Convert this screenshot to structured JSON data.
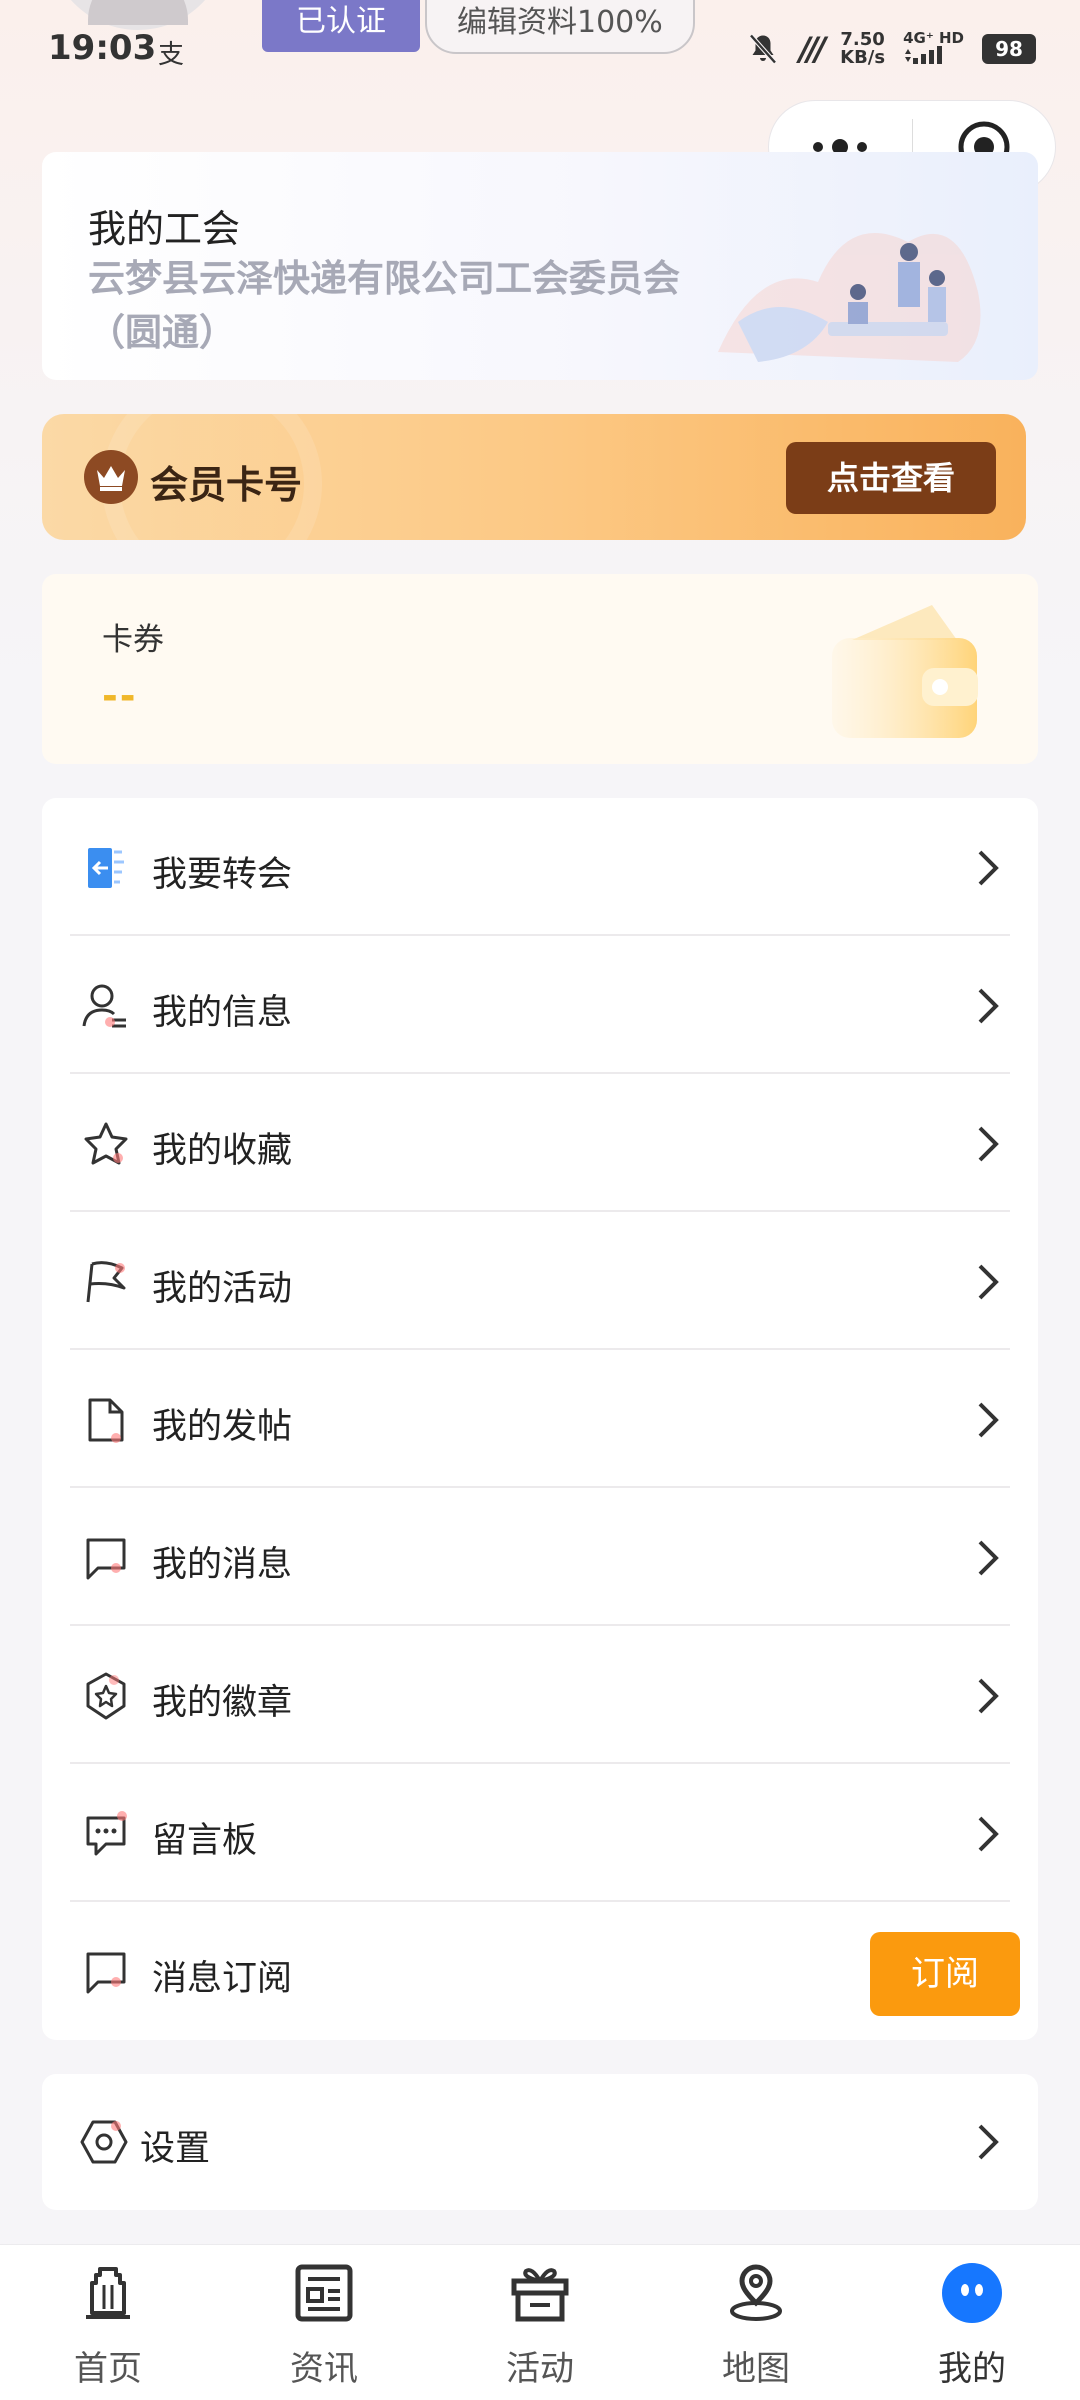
{
  "status_bar": {
    "time": "19:03",
    "pay_icon": "支",
    "net_speed_value": "7.50",
    "net_speed_unit": "KB/s",
    "net_type": "4G⁺ HD",
    "battery": "98"
  },
  "profile": {
    "verified_label": "已认证",
    "completion_label": "编辑资料100%"
  },
  "union": {
    "title": "我的工会",
    "name": "云梦县云泽快递有限公司工会委员会（圆通）"
  },
  "member_card": {
    "label": "会员卡号",
    "button_label": "点击查看"
  },
  "coupon": {
    "label": "卡券",
    "value": "--"
  },
  "menu": {
    "items": [
      {
        "label": "我要转会",
        "icon": "transfer-icon"
      },
      {
        "label": "我的信息",
        "icon": "user-info-icon"
      },
      {
        "label": "我的收藏",
        "icon": "star-icon"
      },
      {
        "label": "我的活动",
        "icon": "flag-icon"
      },
      {
        "label": "我的发帖",
        "icon": "document-icon"
      },
      {
        "label": "我的消息",
        "icon": "message-icon"
      },
      {
        "label": "我的徽章",
        "icon": "badge-icon"
      },
      {
        "label": "留言板",
        "icon": "comment-icon"
      },
      {
        "label": "消息订阅",
        "icon": "subscribe-icon"
      }
    ],
    "subscribe_button": "订阅"
  },
  "settings": {
    "label": "设置",
    "icon": "settings-icon"
  },
  "tabs": [
    {
      "label": "首页",
      "icon": "home-icon"
    },
    {
      "label": "资讯",
      "icon": "news-icon"
    },
    {
      "label": "活动",
      "icon": "gift-icon"
    },
    {
      "label": "地图",
      "icon": "map-pin-icon"
    },
    {
      "label": "我的",
      "icon": "profile-icon",
      "active": true
    }
  ],
  "colors": {
    "accent_orange": "#fb9a0e",
    "member_brown": "#7b3d17",
    "verified_purple": "#7b78c8",
    "active_tab_blue": "#1677ff",
    "coupon_yellow": "#f0b72a"
  }
}
